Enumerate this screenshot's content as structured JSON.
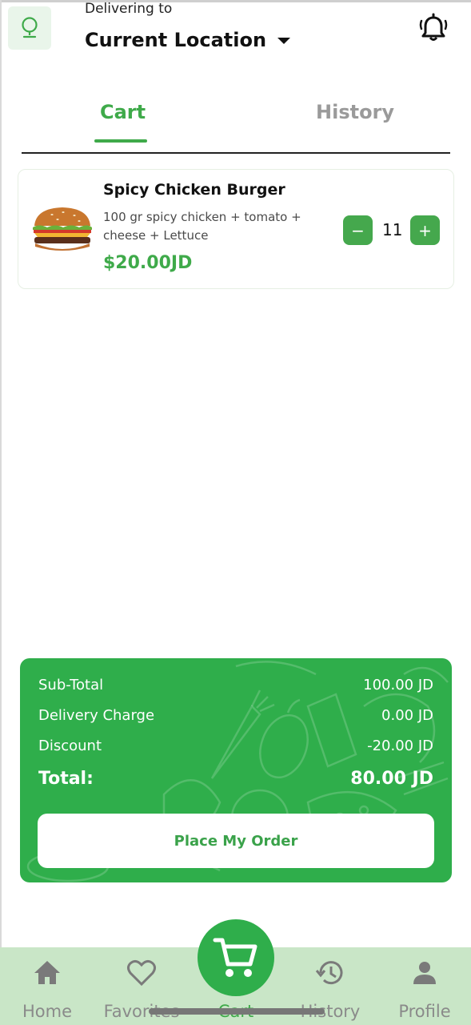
{
  "header": {
    "delivering_label": "Delivering to",
    "location_title": "Current Location",
    "icons": {
      "location": "location-pin-icon",
      "notifications": "bell-icon"
    }
  },
  "tabs": [
    {
      "label": "Cart",
      "active": true
    },
    {
      "label": "History",
      "active": false
    }
  ],
  "cart_items": [
    {
      "name": "Spicy Chicken Burger",
      "description": "100 gr spicy chicken + tomato + cheese + Lettuce",
      "price": "$20.00JD",
      "quantity": "11",
      "minus_label": "−",
      "plus_label": "+"
    }
  ],
  "summary": {
    "subtotal_label": "Sub-Total",
    "subtotal_value": "100.00 JD",
    "delivery_label": "Delivery Charge",
    "delivery_value": "0.00 JD",
    "discount_label": "Discount",
    "discount_value": "-20.00 JD",
    "total_label": "Total:",
    "total_value": "80.00 JD",
    "order_button": "Place My Order"
  },
  "bottom_nav": [
    {
      "label": "Home",
      "icon": "home-icon"
    },
    {
      "label": "Favorites",
      "icon": "heart-icon"
    },
    {
      "label": "Cart",
      "icon": "cart-icon",
      "active": true
    },
    {
      "label": "History",
      "icon": "history-icon"
    },
    {
      "label": "Profile",
      "icon": "profile-icon"
    }
  ],
  "colors": {
    "accent": "#3faa4a",
    "summary_bg": "#2fae4b",
    "nav_bg": "#c9e6c7"
  }
}
